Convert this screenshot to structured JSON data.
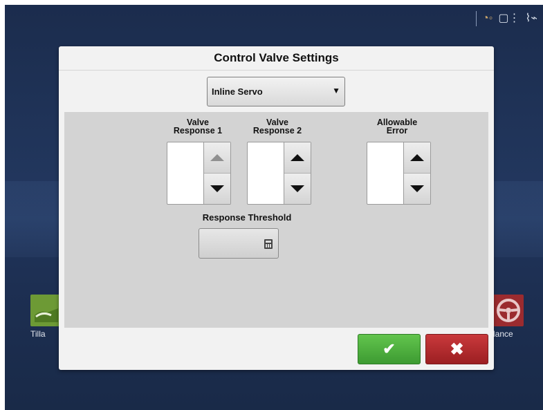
{
  "dialog": {
    "title": "Control Valve Settings",
    "dropdown_value": "Inline Servo",
    "columns": {
      "valve_response_1": {
        "label_line1": "Valve",
        "label_line2": "Response 1",
        "value": ""
      },
      "valve_response_2": {
        "label_line1": "Valve",
        "label_line2": "Response 2",
        "value": ""
      },
      "allowable_error": {
        "label_line1": "Allowable",
        "label_line2": "Error",
        "value": ""
      }
    },
    "response_threshold": {
      "label": "Response Threshold",
      "value": ""
    },
    "actions": {
      "ok_glyph": "✔",
      "cancel_glyph": "✖"
    }
  },
  "background": {
    "tile_left_label": "Tilla",
    "tile_right_label": "lance"
  },
  "colors": {
    "accept": "#4caf3e",
    "cancel": "#b32a2d",
    "panel": "#d3d3d3"
  },
  "icons": [
    "rate-control-icon",
    "display-icon",
    "gps-satellite-icon",
    "calculator-icon",
    "dropdown-caret-icon"
  ]
}
